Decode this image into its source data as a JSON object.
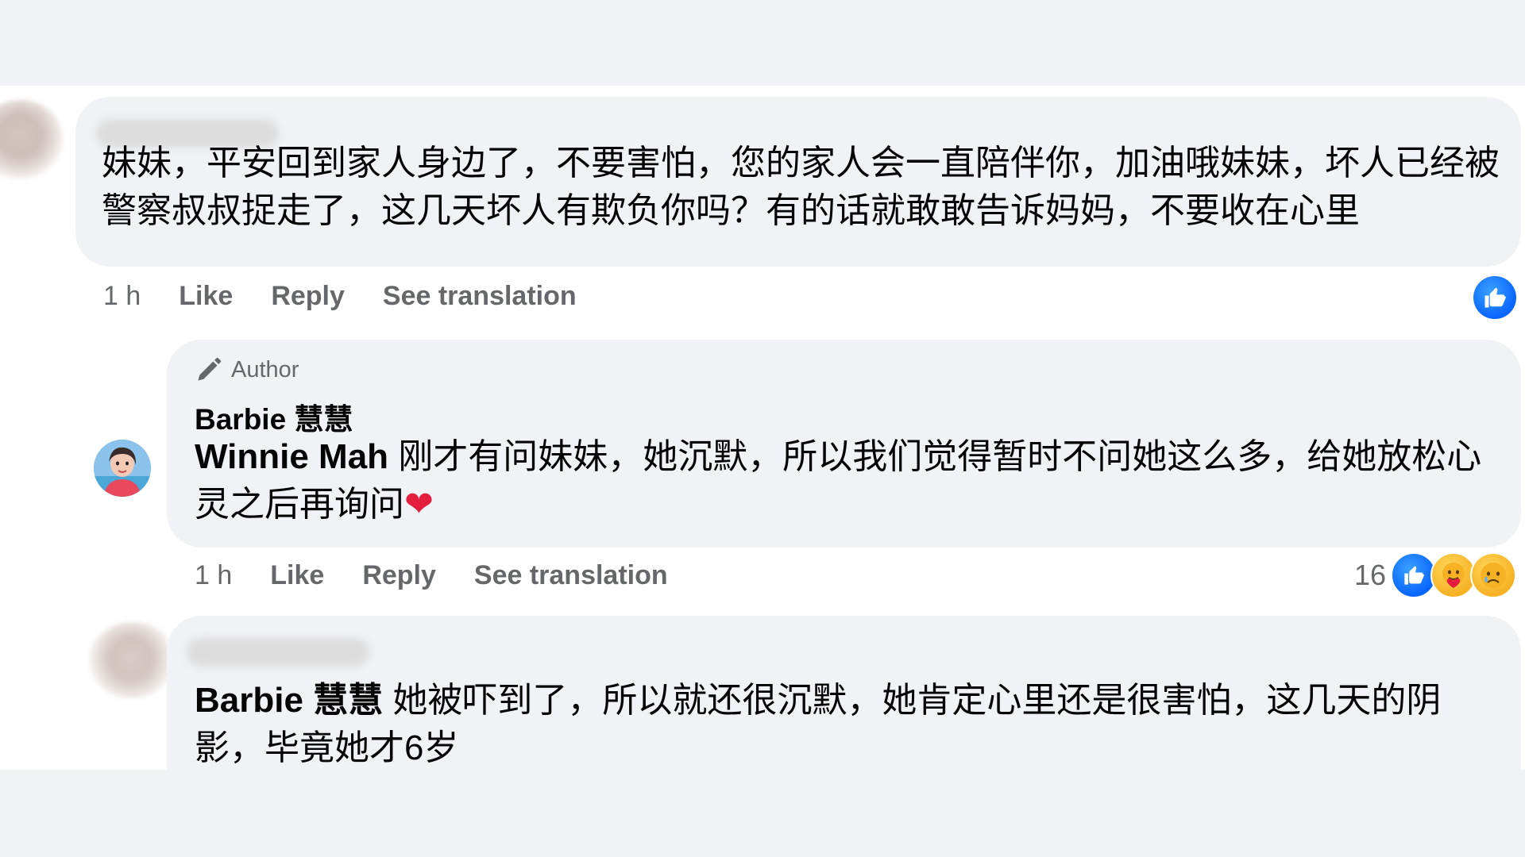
{
  "comments": [
    {
      "text": "妹妹，平安回到家人身边了，不要害怕，您的家人会一直陪伴你，加油哦妹妹，坏人已经被警察叔叔捉走了，这几天坏人有欺负你吗？有的话就敢敢告诉妈妈，不要收在心里",
      "time": "1 h",
      "like_label": "Like",
      "reply_label": "Reply",
      "translate_label": "See translation"
    },
    {
      "badge_label": "Author",
      "author": "Barbie 慧慧",
      "mention": "Winnie Mah",
      "text": " 刚才有问妹妹，她沉默，所以我们觉得暂时不问她这么多，给她放松心灵之后再询问",
      "time": "1 h",
      "like_label": "Like",
      "reply_label": "Reply",
      "translate_label": "See translation",
      "reaction_count": "16"
    },
    {
      "mention": "Barbie 慧慧",
      "text": " 她被吓到了，所以就还很沉默，她肯定心里还是很害怕，这几天的阴影，毕竟她才6岁"
    }
  ],
  "icons": {
    "like": "like-icon",
    "care": "care-emoji-icon",
    "sad": "sad-emoji-icon",
    "pen": "pen-icon",
    "heart": "heart-emoji"
  },
  "colors": {
    "like_blue": "#0866ff",
    "secondary_text": "#65676b",
    "bubble_bg": "#f0f2f5"
  }
}
